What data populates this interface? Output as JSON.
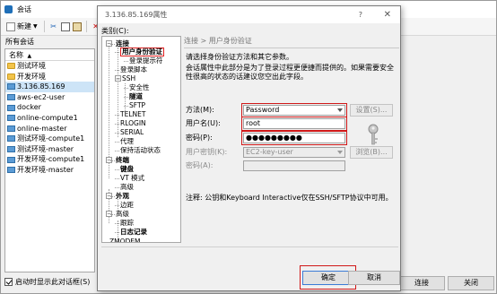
{
  "sessions_window": {
    "title": "会话",
    "toolbar": {
      "new_label": "新建"
    },
    "all_sessions_label": "所有会话",
    "column_name": "名称",
    "items": [
      {
        "type": "folder",
        "label": "测试环境"
      },
      {
        "type": "folder",
        "label": "开发环境"
      },
      {
        "type": "session",
        "label": "3.136.85.169",
        "selected": true
      },
      {
        "type": "session",
        "label": "aws-ec2-user"
      },
      {
        "type": "session",
        "label": "docker"
      },
      {
        "type": "session",
        "label": "online-compute1"
      },
      {
        "type": "session",
        "label": "online-master"
      },
      {
        "type": "session",
        "label": "测试环境-compute1"
      },
      {
        "type": "session",
        "label": "测试环境-master"
      },
      {
        "type": "session",
        "label": "开发环境-compute1"
      },
      {
        "type": "session",
        "label": "开发环境-master"
      }
    ],
    "startup_checkbox_label": "启动时显示此对话框(S)",
    "startup_checked": true,
    "connect_button": "连接",
    "close_button": "关闭"
  },
  "props_dialog": {
    "title": "3.136.85.169属性",
    "help_glyph": "?",
    "close_glyph": "✕",
    "category_label": "类别(C):",
    "tree": [
      {
        "label": "连接",
        "bold": true
      },
      {
        "label": "用户身份验证",
        "bold": true,
        "selected": true
      },
      {
        "label": "登录提示符"
      },
      {
        "label": "登录脚本"
      },
      {
        "label": "SSH"
      },
      {
        "label": "安全性"
      },
      {
        "label": "隧道",
        "bold": true
      },
      {
        "label": "SFTP"
      },
      {
        "label": "TELNET"
      },
      {
        "label": "RLOGIN"
      },
      {
        "label": "SERIAL"
      },
      {
        "label": "代理"
      },
      {
        "label": "保持活动状态"
      },
      {
        "label": "终端",
        "bold": true
      },
      {
        "label": "键盘",
        "bold": true
      },
      {
        "label": "VT 模式"
      },
      {
        "label": "高级"
      },
      {
        "label": "外观",
        "bold": true
      },
      {
        "label": "边距"
      },
      {
        "label": "高级"
      },
      {
        "label": "跟踪"
      },
      {
        "label": "日志记录",
        "bold": true
      },
      {
        "label": "ZMODEM"
      }
    ],
    "breadcrumb": "连接 > 用户身份验证",
    "intro": "请选择身份验证方法和其它参数。",
    "desc": "会话属性中此部分是为了登录过程更便捷而提供的。如果需要安全性很高的状态的话建议您空出此字段。",
    "method_label": "方法(M):",
    "method_value": "Password",
    "settings_button": "设置(S)...",
    "username_label": "用户名(U):",
    "username_value": "root",
    "password_label": "密码(P):",
    "password_value": "●●●●●●●●●",
    "user_key_label": "用户密钥(K):",
    "user_key_value": "EC2-key-user",
    "browse_button": "浏览(B)...",
    "passphrase_label": "密码(A):",
    "note": "注释: 公钥和Keyboard Interactive仅在SSH/SFTP协议中可用。",
    "ok_button": "确定",
    "cancel_button": "取消"
  }
}
